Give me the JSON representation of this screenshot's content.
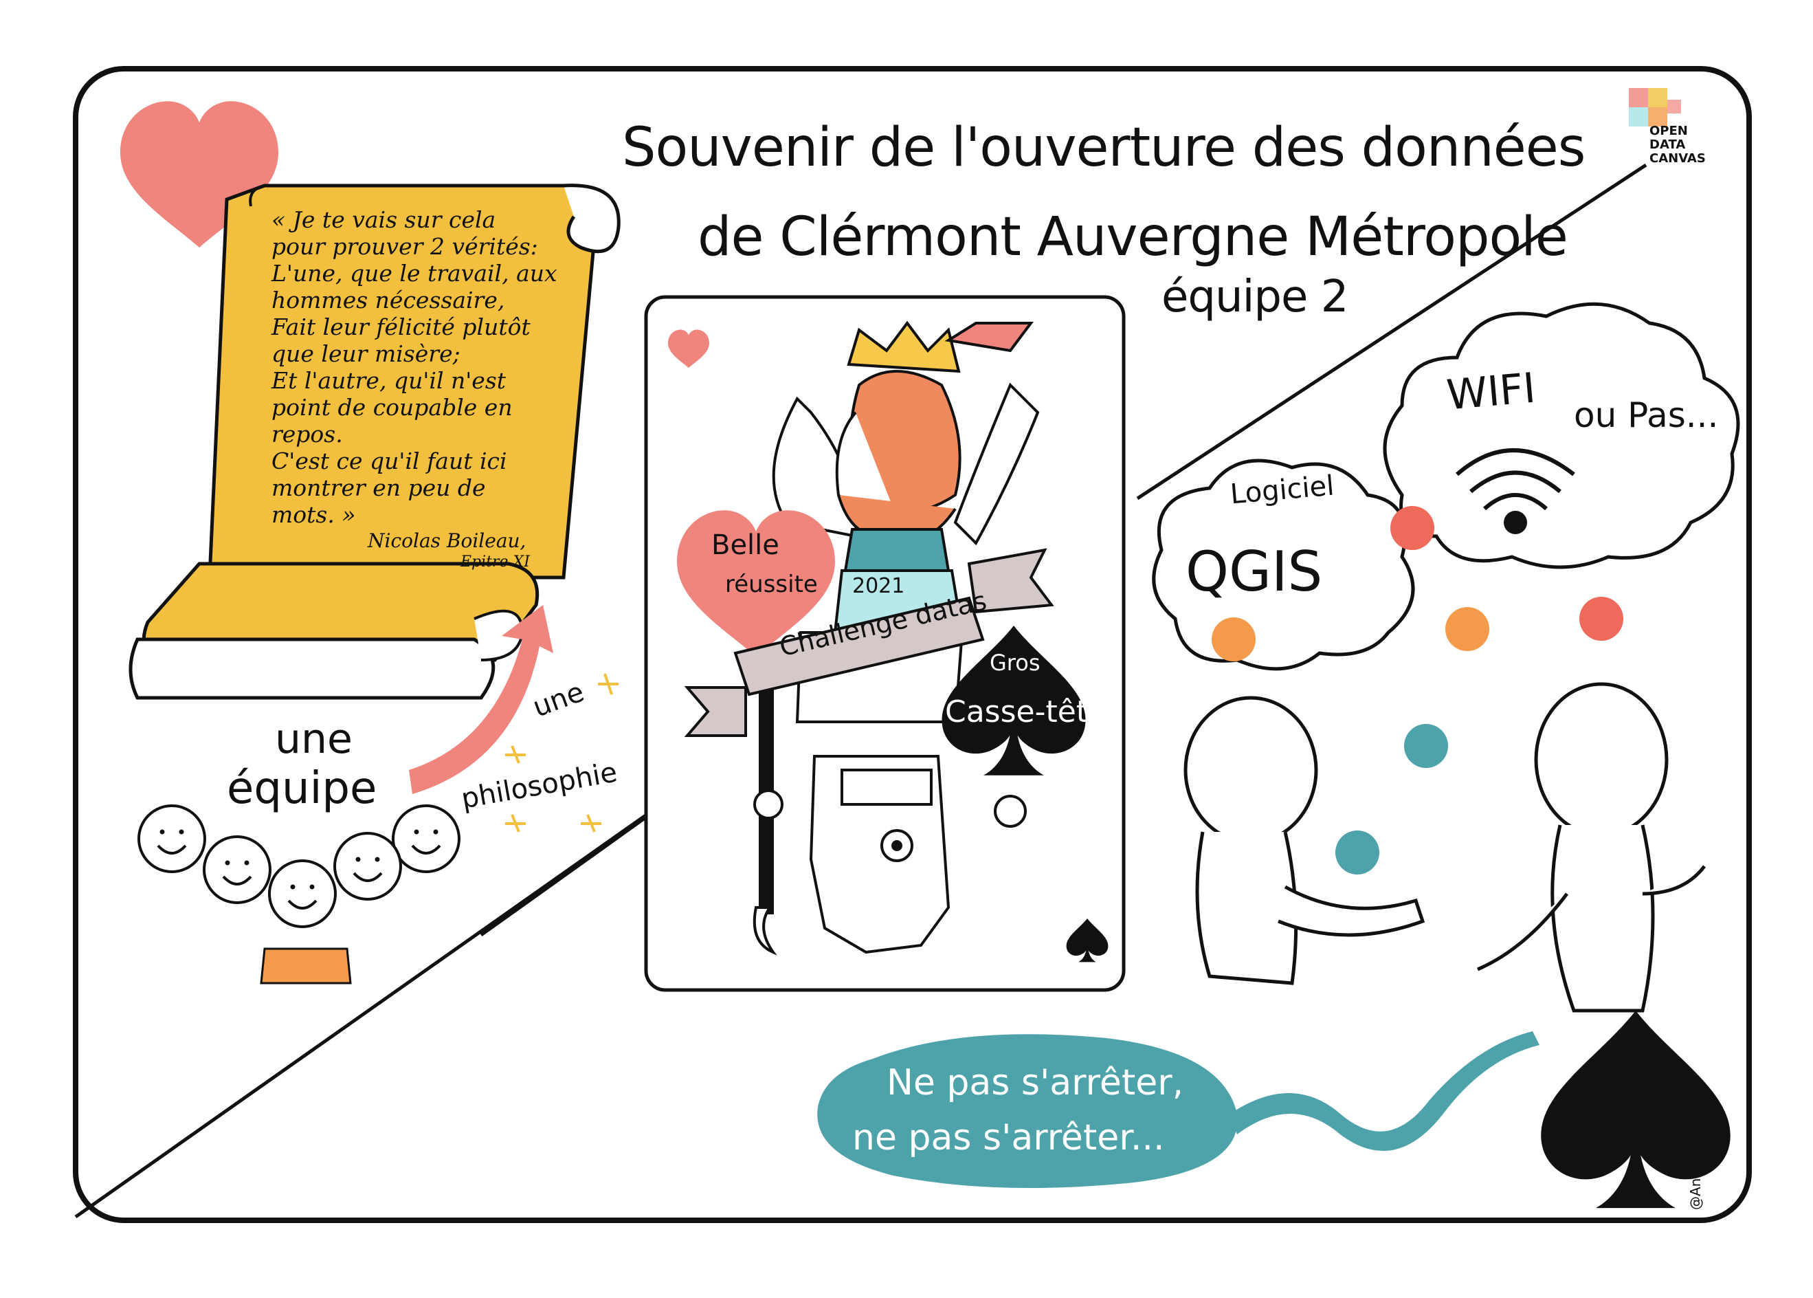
{
  "title": {
    "line1": "Souvenir de l'ouverture des données",
    "line2": "de Clérmont Auvergne Métropole",
    "team": "équipe 2"
  },
  "logo": {
    "line1": "OPEN",
    "line2": "DATA",
    "line3": "CANVAS"
  },
  "quote": {
    "lines": [
      "« Je te vais sur cela",
      "pour prouver 2 vérités:",
      "L'une, que le travail, aux",
      "hommes nécessaire,",
      "Fait leur félicité plutôt",
      "que leur misère;",
      "Et l'autre, qu'il n'est",
      "point de coupable en",
      "repos.",
      "C'est ce qu'il faut ici",
      "montrer en peu de",
      "mots. »"
    ],
    "author": "Nicolas Boileau,",
    "source": "Epitre XI"
  },
  "team_labels": {
    "une": "une",
    "equipe": "équipe",
    "une2": "une",
    "philosophie": "philosophie"
  },
  "card": {
    "heart_label_1": "Belle",
    "heart_label_2": "réussite",
    "year": "2021",
    "banner": "Challenge datas",
    "spade_label_1": "Gros",
    "spade_label_2": "Casse-tête"
  },
  "clouds": {
    "logiciel": "Logiciel",
    "qgis": "QGIS",
    "wifi": "WIFI",
    "ou_pas": "ou Pas..."
  },
  "speech": {
    "line1": "Ne pas s'arrêter,",
    "line2": "ne pas s'arrêter..."
  },
  "signature": "@AnneCallejon",
  "colors": {
    "salmon": "#ef857d",
    "mustard": "#f2c03e",
    "teal": "#4ea3ab",
    "orange": "#f49b4b",
    "red_ball": "#ee6a5a",
    "card_mint": "#b7e9ea",
    "banner_grey": "#d5c8c8",
    "hair": "#f08a5d",
    "crown": "#f6c94a"
  }
}
